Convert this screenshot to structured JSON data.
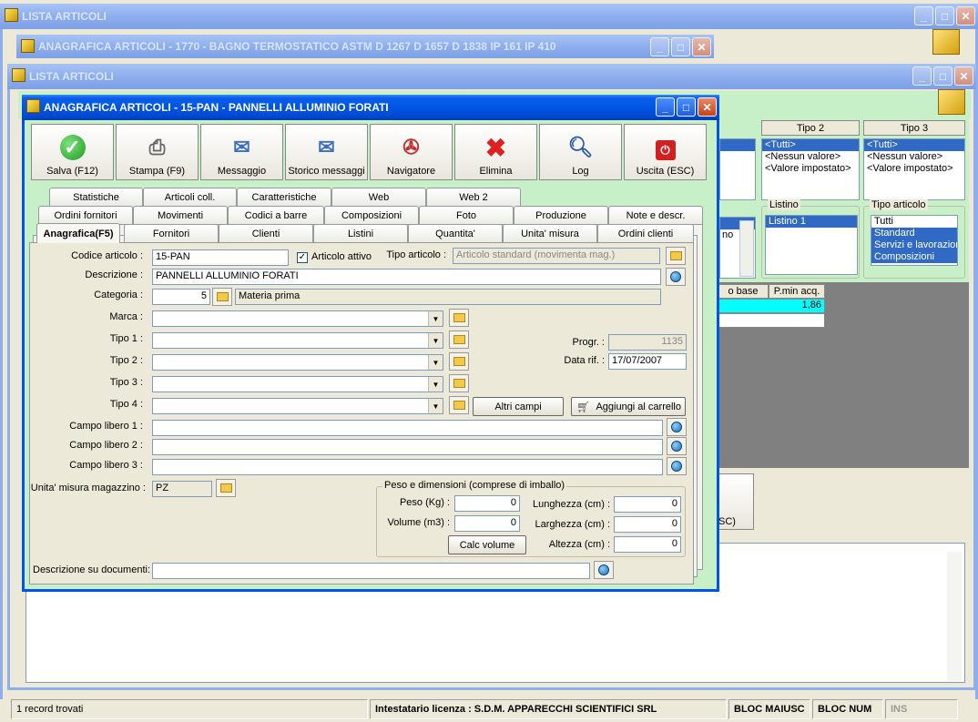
{
  "bg_window1": {
    "title": "LISTA ARTICOLI"
  },
  "bg_window2": {
    "title": "ANAGRAFICA ARTICOLI - 1770 - BAGNO TERMOSTATICO ASTM D 1267 D 1657 D 1838 IP 161 IP 410"
  },
  "bg_window3": {
    "title": "LISTA ARTICOLI",
    "tipo2": {
      "header": "Tipo 2",
      "items": [
        "<Tutti>",
        "<Nessun valore>",
        "<Valore impostato>"
      ]
    },
    "tipo3": {
      "header": "Tipo 3",
      "items": [
        "<Tutti>",
        "<Nessun valore>",
        "<Valore impostato>"
      ]
    },
    "listino": {
      "header": "Listino",
      "items": [
        "Listino 1"
      ]
    },
    "tipo_articolo": {
      "header": "Tipo articolo",
      "items": [
        "Tutti",
        "Standard",
        "Servizi e lavorazioni",
        "Composizioni"
      ]
    },
    "grid": {
      "col1": "o base",
      "col2": "P.min acq.",
      "value": "1,86"
    },
    "partial_no": "no",
    "partial_esc": "SC)"
  },
  "window": {
    "title": "ANAGRAFICA ARTICOLI - 15-PAN - PANNELLI ALLUMINIO FORATI",
    "toolbar": [
      {
        "label": "Salva (F12)",
        "icon": "check-icon"
      },
      {
        "label": "Stampa (F9)",
        "icon": "printer-icon"
      },
      {
        "label": "Messaggio",
        "icon": "envelope-pen-icon"
      },
      {
        "label": "Storico messaggi",
        "icon": "envelope-search-icon"
      },
      {
        "label": "Navigatore",
        "icon": "compass-icon"
      },
      {
        "label": "Elimina",
        "icon": "red-x-icon"
      },
      {
        "label": "Log",
        "icon": "magnifier-icon"
      },
      {
        "label": "Uscita (ESC)",
        "icon": "power-icon"
      }
    ],
    "tabs_row1": [
      "Statistiche",
      "Articoli coll.",
      "Caratteristiche",
      "Web",
      "Web 2"
    ],
    "tabs_row2": [
      "Ordini fornitori",
      "Movimenti",
      "Codici a barre",
      "Composizioni",
      "Foto",
      "Produzione",
      "Note e descr."
    ],
    "tabs_row3": [
      "Anagrafica(F5)",
      "Fornitori",
      "Clienti",
      "Listini",
      "Quantita'",
      "Unita' misura",
      "Ordini clienti"
    ],
    "form": {
      "codice_label": "Codice articolo :",
      "codice_value": "15-PAN",
      "attivo_label": "Articolo attivo",
      "tipo_articolo_label": "Tipo articolo :",
      "tipo_articolo_value": "Articolo standard (movimenta mag.)",
      "descrizione_label": "Descrizione :",
      "descrizione_value": "PANNELLI ALLUMINIO FORATI",
      "categoria_label": "Categoria :",
      "categoria_value": "5",
      "categoria_desc": "Materia prima",
      "marca_label": "Marca :",
      "tipo1_label": "Tipo 1 :",
      "tipo2_label": "Tipo 2 :",
      "tipo3_label": "Tipo 3 :",
      "tipo4_label": "Tipo 4 :",
      "progr_label": "Progr. :",
      "progr_value": "1135",
      "data_label": "Data rif. :",
      "data_value": "17/07/2007",
      "altri_campi": "Altri campi",
      "aggiungi": "Aggiungi al carrello",
      "campo1_label": "Campo libero 1 :",
      "campo2_label": "Campo libero 2 :",
      "campo3_label": "Campo libero 3 :",
      "unita_label": "Unita' misura magazzino :",
      "unita_value": "PZ",
      "peso_group": "Peso e dimensioni (comprese di imballo)",
      "peso_label": "Peso (Kg) :",
      "peso_value": "0",
      "volume_label": "Volume (m3) :",
      "volume_value": "0",
      "lunghezza_label": "Lunghezza (cm) :",
      "lunghezza_value": "0",
      "larghezza_label": "Larghezza (cm) :",
      "larghezza_value": "0",
      "altezza_label": "Altezza (cm) :",
      "altezza_value": "0",
      "calc_volume": "Calc volume",
      "desc_doc_label": "Descrizione su documenti:"
    }
  },
  "statusbar": {
    "records": "1 record trovati",
    "license": "Intestatario licenza : S.D.M. APPARECCHI SCIENTIFICI SRL",
    "caps": "BLOC MAIUSC",
    "num": "BLOC NUM",
    "ins": "INS"
  },
  "colors": {
    "titlebar": "#0055E5",
    "selection": "#316AC5",
    "grid_highlight": "#00FFFF",
    "form_bg": "#C8F0C8"
  }
}
